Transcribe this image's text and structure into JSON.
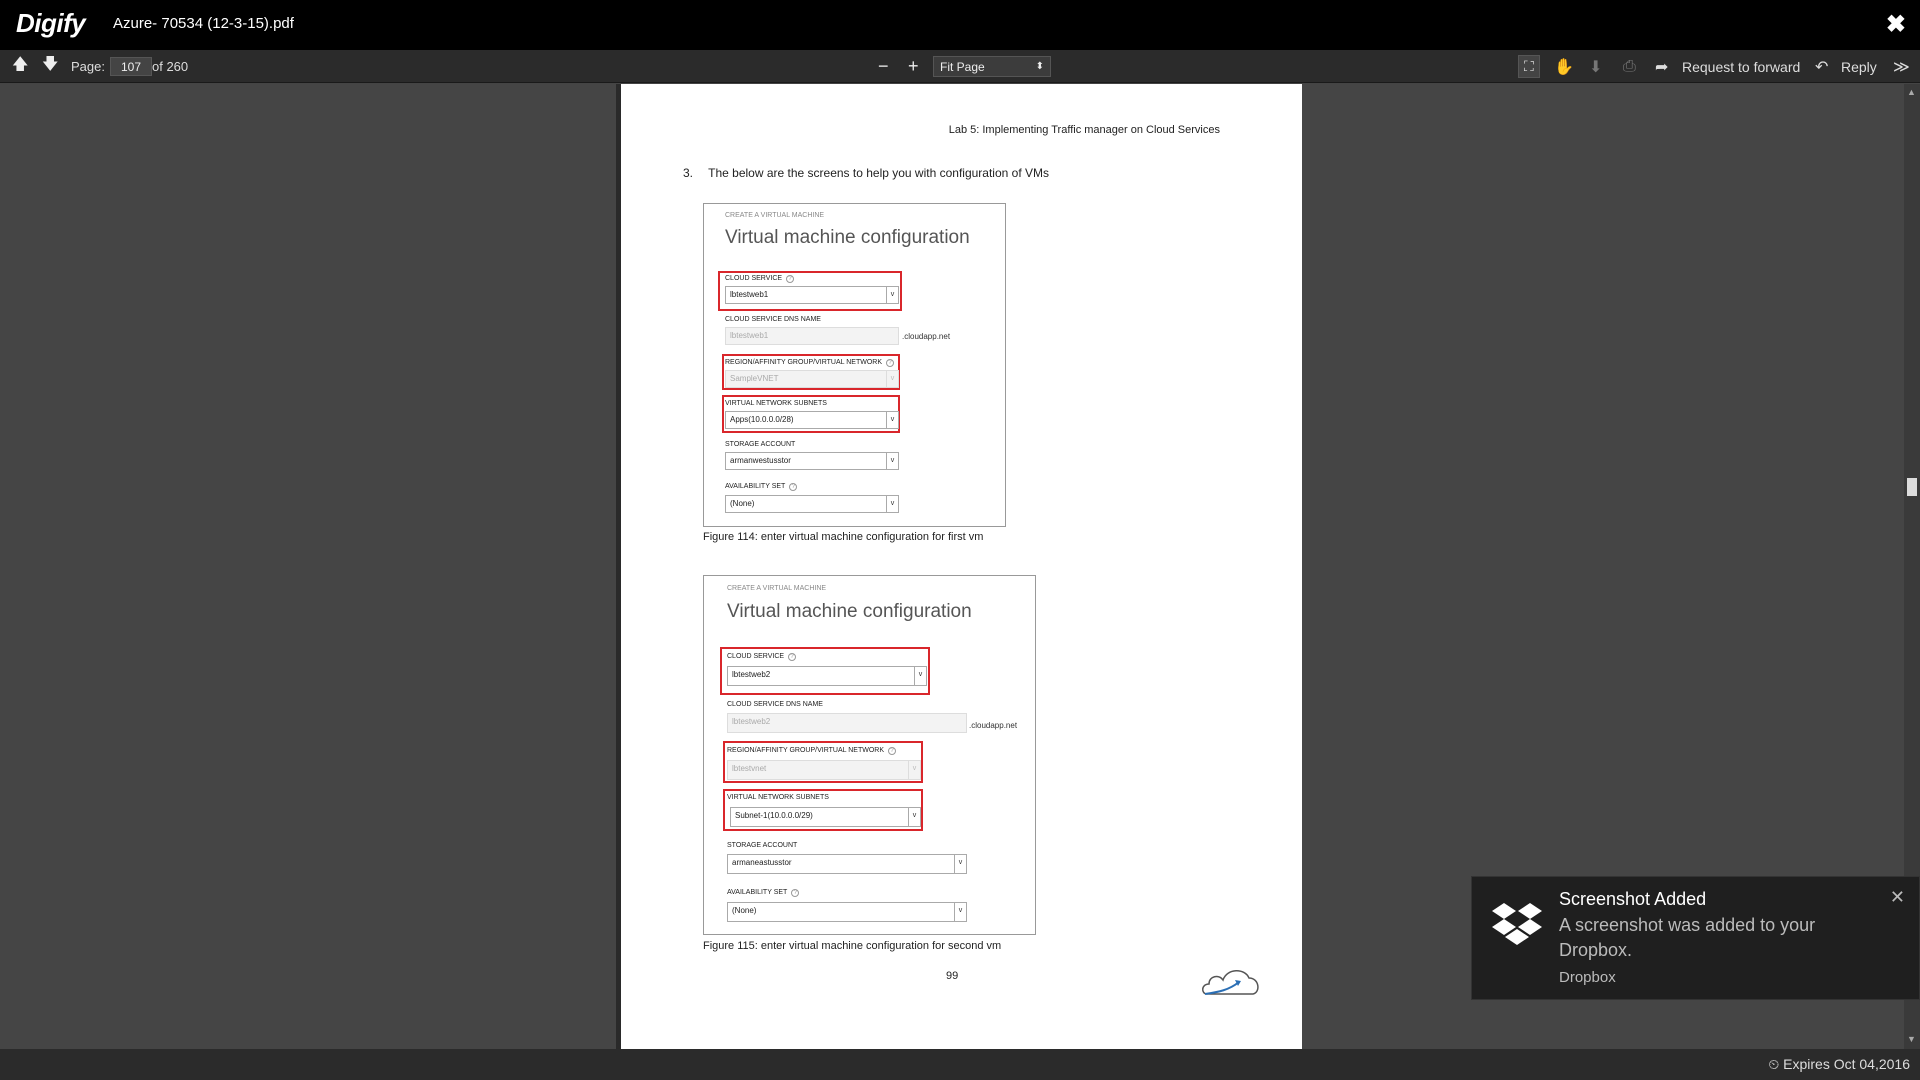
{
  "app": {
    "logo": "Digify",
    "doc_title": "Azure- 70534 (12-3-15).pdf",
    "close_glyph": "✖"
  },
  "toolbar": {
    "up_glyph": "🡅",
    "down_glyph": "🡇",
    "page_label": "Page:",
    "page_value": "107",
    "page_total": "of 260",
    "zoom_out": "−",
    "zoom_in": "+",
    "fit_value": "Fit Page",
    "fit_arrow": "⬍",
    "fullscreen_glyph": "⛶",
    "hand_glyph": "✋",
    "download_glyph": "⬇",
    "print_glyph": "⎙",
    "forward_glyph": "➦",
    "forward_label": "Request to forward",
    "reply_glyph": "↶",
    "reply_label": "Reply",
    "more_glyph": "≫"
  },
  "pdf": {
    "header": "Lab 5: Implementing Traffic manager on Cloud Services",
    "step_num": "3.",
    "step_text": "The below are the screens to help you with configuration of VMs",
    "fig1": {
      "small_caption": "CREATE A VIRTUAL MACHINE",
      "heading": "Virtual machine configuration",
      "cloud_service_label": "CLOUD SERVICE",
      "cloud_service_value": "lbtestweb1",
      "dns_label": "CLOUD SERVICE DNS NAME",
      "dns_value": "lbtestweb1",
      "dns_suffix": ".cloudapp.net",
      "region_label": "REGION/AFFINITY GROUP/VIRTUAL NETWORK",
      "region_value": "SampleVNET",
      "subnets_label": "VIRTUAL NETWORK SUBNETS",
      "subnets_value": "Apps(10.0.0.0/28)",
      "storage_label": "STORAGE ACCOUNT",
      "storage_value": "armanwestusstor",
      "avail_label": "AVAILABILITY SET",
      "avail_value": "(None)",
      "caption": "Figure 114: enter virtual machine configuration for first vm"
    },
    "fig2": {
      "small_caption": "CREATE A VIRTUAL MACHINE",
      "heading": "Virtual machine configuration",
      "cloud_service_label": "CLOUD SERVICE",
      "cloud_service_value": "lbtestweb2",
      "dns_label": "CLOUD SERVICE DNS NAME",
      "dns_value": "lbtestweb2",
      "dns_suffix": ".cloudapp.net",
      "region_label": "REGION/AFFINITY GROUP/VIRTUAL NETWORK",
      "region_value": "lbtestvnet",
      "subnets_label": "VIRTUAL NETWORK SUBNETS",
      "subnets_value": "Subnet-1(10.0.0.0/29)",
      "storage_label": "STORAGE ACCOUNT",
      "storage_value": "armaneastusstor",
      "avail_label": "AVAILABILITY SET",
      "avail_value": "(None)",
      "caption": "Figure 115: enter virtual machine configuration for second vm"
    },
    "page_number": "99",
    "dropdown_glyph": "v",
    "help_glyph": "?"
  },
  "scrollbar": {
    "up": "▲",
    "down": "▼"
  },
  "footer": {
    "expires": "⏲ Expires Oct 04,2016"
  },
  "toast": {
    "title": "Screenshot Added",
    "message": "A screenshot was added to your Dropbox.",
    "source": "Dropbox",
    "close_glyph": "✕",
    "icon": "dropbox-icon"
  },
  "colors": {
    "highlight_red": "#d9262b",
    "titlebar": "#000000",
    "toolbar": "#2b2b2b",
    "viewer_bg": "#454545"
  }
}
